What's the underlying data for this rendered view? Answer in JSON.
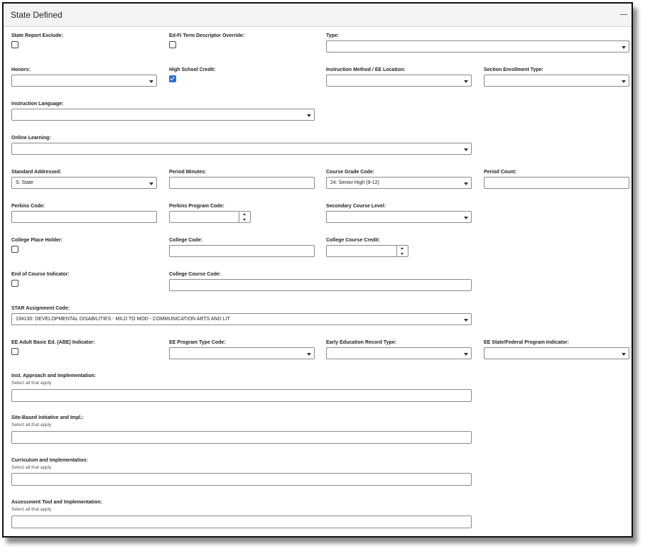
{
  "header": {
    "title": "State Defined"
  },
  "labels": {
    "state_report_exclude": "State Report Exclude:",
    "edfi_override": "Ed-Fi Term Descriptor Override:",
    "type": "Type:",
    "honors": "Honors:",
    "hs_credit": "High School Credit:",
    "instruction_method": "Instruction Method / EE Location:",
    "section_enrollment_type": "Section Enrollment Type:",
    "instruction_language": "Instruction Language:",
    "online_learning": "Online Learning:",
    "standard_addressed": "Standard Addressed:",
    "period_minutes": "Period Minutes:",
    "course_grade_code": "Course Grade Code:",
    "period_count": "Period Count:",
    "perkins_code": "Perkins Code:",
    "perkins_program_code": "Perkins Program Code:",
    "secondary_course_level": "Secondary Course Level:",
    "college_place_holder": "College Place Holder:",
    "college_code": "College Code:",
    "college_course_credit": "College Course Credit:",
    "eoc_indicator": "End of Course Indicator:",
    "college_course_code": "College Course Code:",
    "star_assignment_code": "STAR Assignment Code:",
    "ee_abe_indicator": "EE Adult Basic Ed. (ABE) Indicator:",
    "ee_program_type_code": "EE Program Type Code:",
    "early_ed_record_type": "Early Education Record Type:",
    "ee_state_federal": "EE State/Federal Program Indicator:",
    "inst_approach": "Inst. Approach and Implementation:",
    "site_based": "Site-Based Initiative and Impl.:",
    "curriculum": "Curriculum and Implementation:",
    "assessment_tool": "Assessment Tool and Implementation:",
    "select_all_hint": "Select all that apply"
  },
  "values": {
    "standard_addressed": "S: State",
    "course_grade_code": "24: Senior High (9-12)",
    "star_assignment_code": "194130: DEVELOPMENTAL DISABILITIES - MILD TO MOD - COMMUNICATION ARTS AND LIT"
  },
  "checkboxes": {
    "state_report_exclude": false,
    "edfi_override": false,
    "hs_credit": true,
    "college_place_holder": false,
    "eoc_indicator": false,
    "ee_abe_indicator": false
  },
  "colors": {
    "accent": "#2f6fd6",
    "header_bg": "#f3f3f3",
    "border": "#8a8a8a"
  },
  "icons": {
    "collapse": "minus-icon",
    "dropdown": "chevron-down-icon",
    "spinner": "up-down-arrows-icon"
  }
}
